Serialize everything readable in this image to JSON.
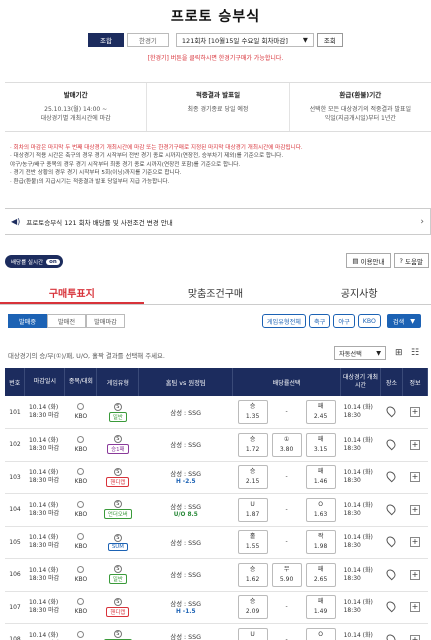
{
  "title": "프로토 승부식",
  "filters": {
    "tab_game": "조합",
    "tab_single": "한경기",
    "round": "121회차 [10월15일 수요일 회차마감]",
    "query": "조회"
  },
  "hint": "[한경기] 버튼을 클릭하시면 한경기구매가 가능합니다.",
  "info": [
    {
      "title": "발매기간",
      "lines": [
        "25.10.13(월) 14:00 ~",
        "대상경기별 개최시간에 마감"
      ]
    },
    {
      "title": "적중결과 발표일",
      "lines": [
        "최종 경기종료 당일 예정"
      ]
    },
    {
      "title": "환급(환불)기간",
      "lines": [
        "선택한 모든 대상경기의 적중결과 발표일",
        "익일(지급개시일)부터 1년간"
      ]
    }
  ],
  "notes": [
    "· 회차의 마감은 마지막 두 번째 대상경기 개최시간에 마감 또는 한경기구매로 지정된 마지막 대상경기 개최시간에 마감됩니다.",
    "· 대상경기 적용 시간은 축구의 경우 경기 시작부터 전반 경기 종료 시까지(연장전, 승부차기 제외)를 기준으로 합니다.",
    "  야구/농구/배구 종목의 경우 경기 시작부터 최종 경기 종료 시까지(연장전 포함)를 기준으로 합니다.",
    "· 경기 전반 상황의 경우 경기 시작부터 5회(이닝)까지를 기준으로 합니다.",
    "· 환급(환불)의 지급시기는 적중결과 발표 당일부터 지급 가능합니다."
  ],
  "notice": "프로토승부식 121 회차 배당률 및 사전조건 변경 안내",
  "realtime": {
    "label": "배당률 실시간",
    "state": "on"
  },
  "top_buttons": [
    "이용안내",
    "도움말"
  ],
  "main_tabs": [
    "구매투표지",
    "맞춤조건구매",
    "공지사항"
  ],
  "sub_buttons": [
    "발매중",
    "발매전",
    "발매마감"
  ],
  "sport_filters": [
    "게임유형전체",
    "축구",
    "야구",
    "KBO"
  ],
  "search_label": "검색",
  "instruction": "대상경기의 승/무(①)/패, U/O, 홀짝 결과를 선택해 주세요.",
  "auto_select": "자동선택",
  "table_headers": [
    "번호",
    "마감일시",
    "종목/대회",
    "게임유형",
    "홈팀 vs 원정팀",
    "배당률선택",
    "대상경기 개최시간",
    "장소",
    "정보"
  ],
  "rows": [
    {
      "no": "101",
      "date": "10.14 (화)",
      "time": "18:30 마감",
      "league": "KBO",
      "type": "일반",
      "type_color": "green",
      "handicap": "",
      "hc_color": "",
      "match": "삼성 : SSG",
      "o1l": "승",
      "o1v": "1.35",
      "o2l": "-",
      "o2v": "",
      "o3l": "패",
      "o3v": "2.45",
      "gdate": "10.14 (화)",
      "gtime": "18:30"
    },
    {
      "no": "102",
      "date": "10.14 (화)",
      "time": "18:30 마감",
      "league": "KBO",
      "type": "승1패",
      "type_color": "purple",
      "handicap": "",
      "hc_color": "",
      "match": "삼성 : SSG",
      "o1l": "승",
      "o1v": "1.72",
      "o2l": "①",
      "o2v": "3.80",
      "o3l": "패",
      "o3v": "3.15",
      "gdate": "10.14 (화)",
      "gtime": "18:30"
    },
    {
      "no": "103",
      "date": "10.14 (화)",
      "time": "18:30 마감",
      "league": "KBO",
      "type": "핸디캡",
      "type_color": "red",
      "handicap": "H -2.5",
      "hc_color": "blue",
      "match": "삼성 : SSG",
      "o1l": "승",
      "o1v": "2.15",
      "o2l": "-",
      "o2v": "",
      "o3l": "패",
      "o3v": "1.46",
      "gdate": "10.14 (화)",
      "gtime": "18:30"
    },
    {
      "no": "104",
      "date": "10.14 (화)",
      "time": "18:30 마감",
      "league": "KBO",
      "type": "언더오버",
      "type_color": "green",
      "handicap": "U/O 8.5",
      "hc_color": "green",
      "match": "삼성 : SSG",
      "o1l": "U",
      "o1v": "1.87",
      "o2l": "-",
      "o2v": "",
      "o3l": "O",
      "o3v": "1.63",
      "gdate": "10.14 (화)",
      "gtime": "18:30"
    },
    {
      "no": "105",
      "date": "10.14 (화)",
      "time": "18:30 마감",
      "league": "KBO",
      "type": "SUM",
      "type_color": "blue",
      "handicap": "",
      "hc_color": "",
      "match": "삼성 : SSG",
      "o1l": "홀",
      "o1v": "1.55",
      "o2l": "-",
      "o2v": "",
      "o3l": "짝",
      "o3v": "1.98",
      "gdate": "10.14 (화)",
      "gtime": "18:30"
    },
    {
      "no": "106",
      "date": "10.14 (화)",
      "time": "18:30 마감",
      "league": "KBO",
      "type": "일반",
      "type_color": "green",
      "handicap": "",
      "hc_color": "",
      "match": "삼성 : SSG",
      "o1l": "승",
      "o1v": "1.62",
      "o2l": "무",
      "o2v": "5.90",
      "o3l": "패",
      "o3v": "2.65",
      "gdate": "10.14 (화)",
      "gtime": "18:30"
    },
    {
      "no": "107",
      "date": "10.14 (화)",
      "time": "18:30 마감",
      "league": "KBO",
      "type": "핸디캡",
      "type_color": "red",
      "handicap": "H -1.5",
      "hc_color": "blue",
      "match": "삼성 : SSG",
      "o1l": "승",
      "o1v": "2.09",
      "o2l": "-",
      "o2v": "",
      "o3l": "패",
      "o3v": "1.49",
      "gdate": "10.14 (화)",
      "gtime": "18:30"
    },
    {
      "no": "108",
      "date": "10.14 (화)",
      "time": "18:30 마감",
      "league": "KBO",
      "type": "언더오버",
      "type_color": "green",
      "handicap": "U/O 4.5",
      "hc_color": "green",
      "match": "삼성 : SSG",
      "o1l": "U",
      "o1v": "1.77",
      "o2l": "-",
      "o2v": "",
      "o3l": "O",
      "o3v": "1.71",
      "gdate": "10.14 (화)",
      "gtime": "18:30"
    }
  ]
}
